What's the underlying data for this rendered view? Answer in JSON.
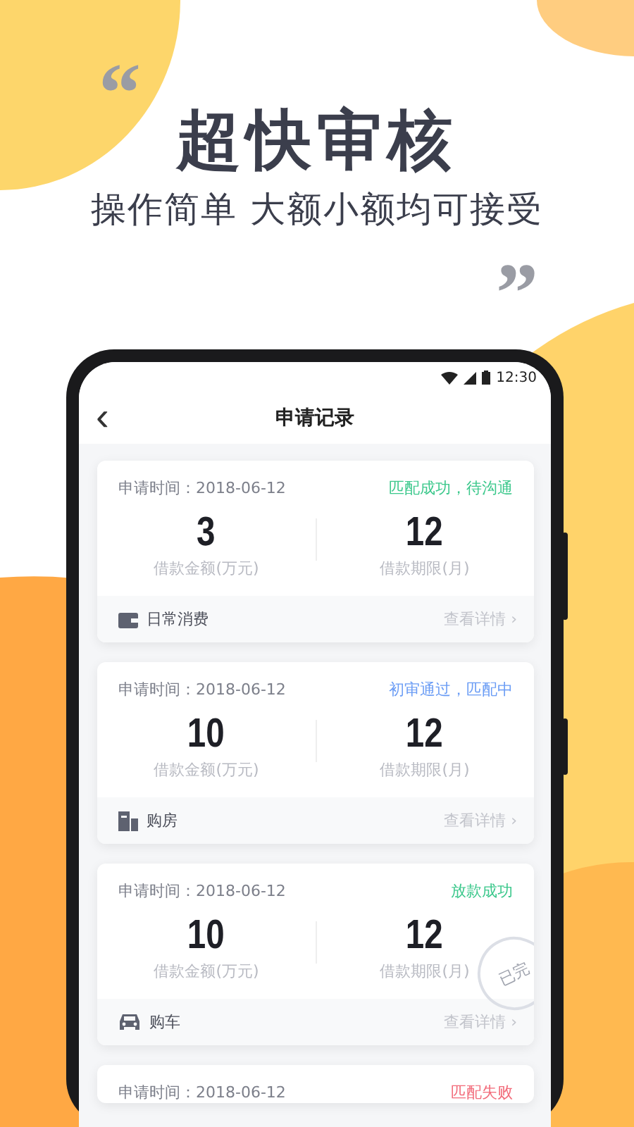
{
  "banner": {
    "quote_open": "“",
    "title": "超快审核",
    "subtitle": "操作简单 大额小额均可接受",
    "quote_close": "”"
  },
  "status_bar": {
    "time": "12:30"
  },
  "nav": {
    "back": "‹",
    "title": "申请记录"
  },
  "records": [
    {
      "date": "申请时间：2018-06-12",
      "status": "匹配成功，待沟通",
      "color": "#3cc88c",
      "amount": "3",
      "amount_label": "借款金额(万元)",
      "term": "12",
      "term_label": "借款期限(月)",
      "kind": "wallet",
      "category": "日常消费",
      "detail": "查看详情 ›"
    },
    {
      "date": "申请时间：2018-06-12",
      "status": "初审通过，匹配中",
      "color": "#6a9cf5",
      "amount": "10",
      "amount_label": "借款金额(万元)",
      "term": "12",
      "term_label": "借款期限(月)",
      "kind": "house",
      "category": "购房",
      "detail": "查看详情 ›"
    },
    {
      "date": "申请时间：2018-06-12",
      "status": "放款成功",
      "color": "#3cc88c",
      "amount": "10",
      "amount_label": "借款金额(万元)",
      "term": "12",
      "term_label": "借款期限(月)",
      "kind": "car",
      "category": "购车",
      "detail": "查看详情 ›",
      "stamp": "已完"
    },
    {
      "date": "申请时间：2018-06-12",
      "status": "匹配失败",
      "color": "#f26b7a"
    }
  ]
}
